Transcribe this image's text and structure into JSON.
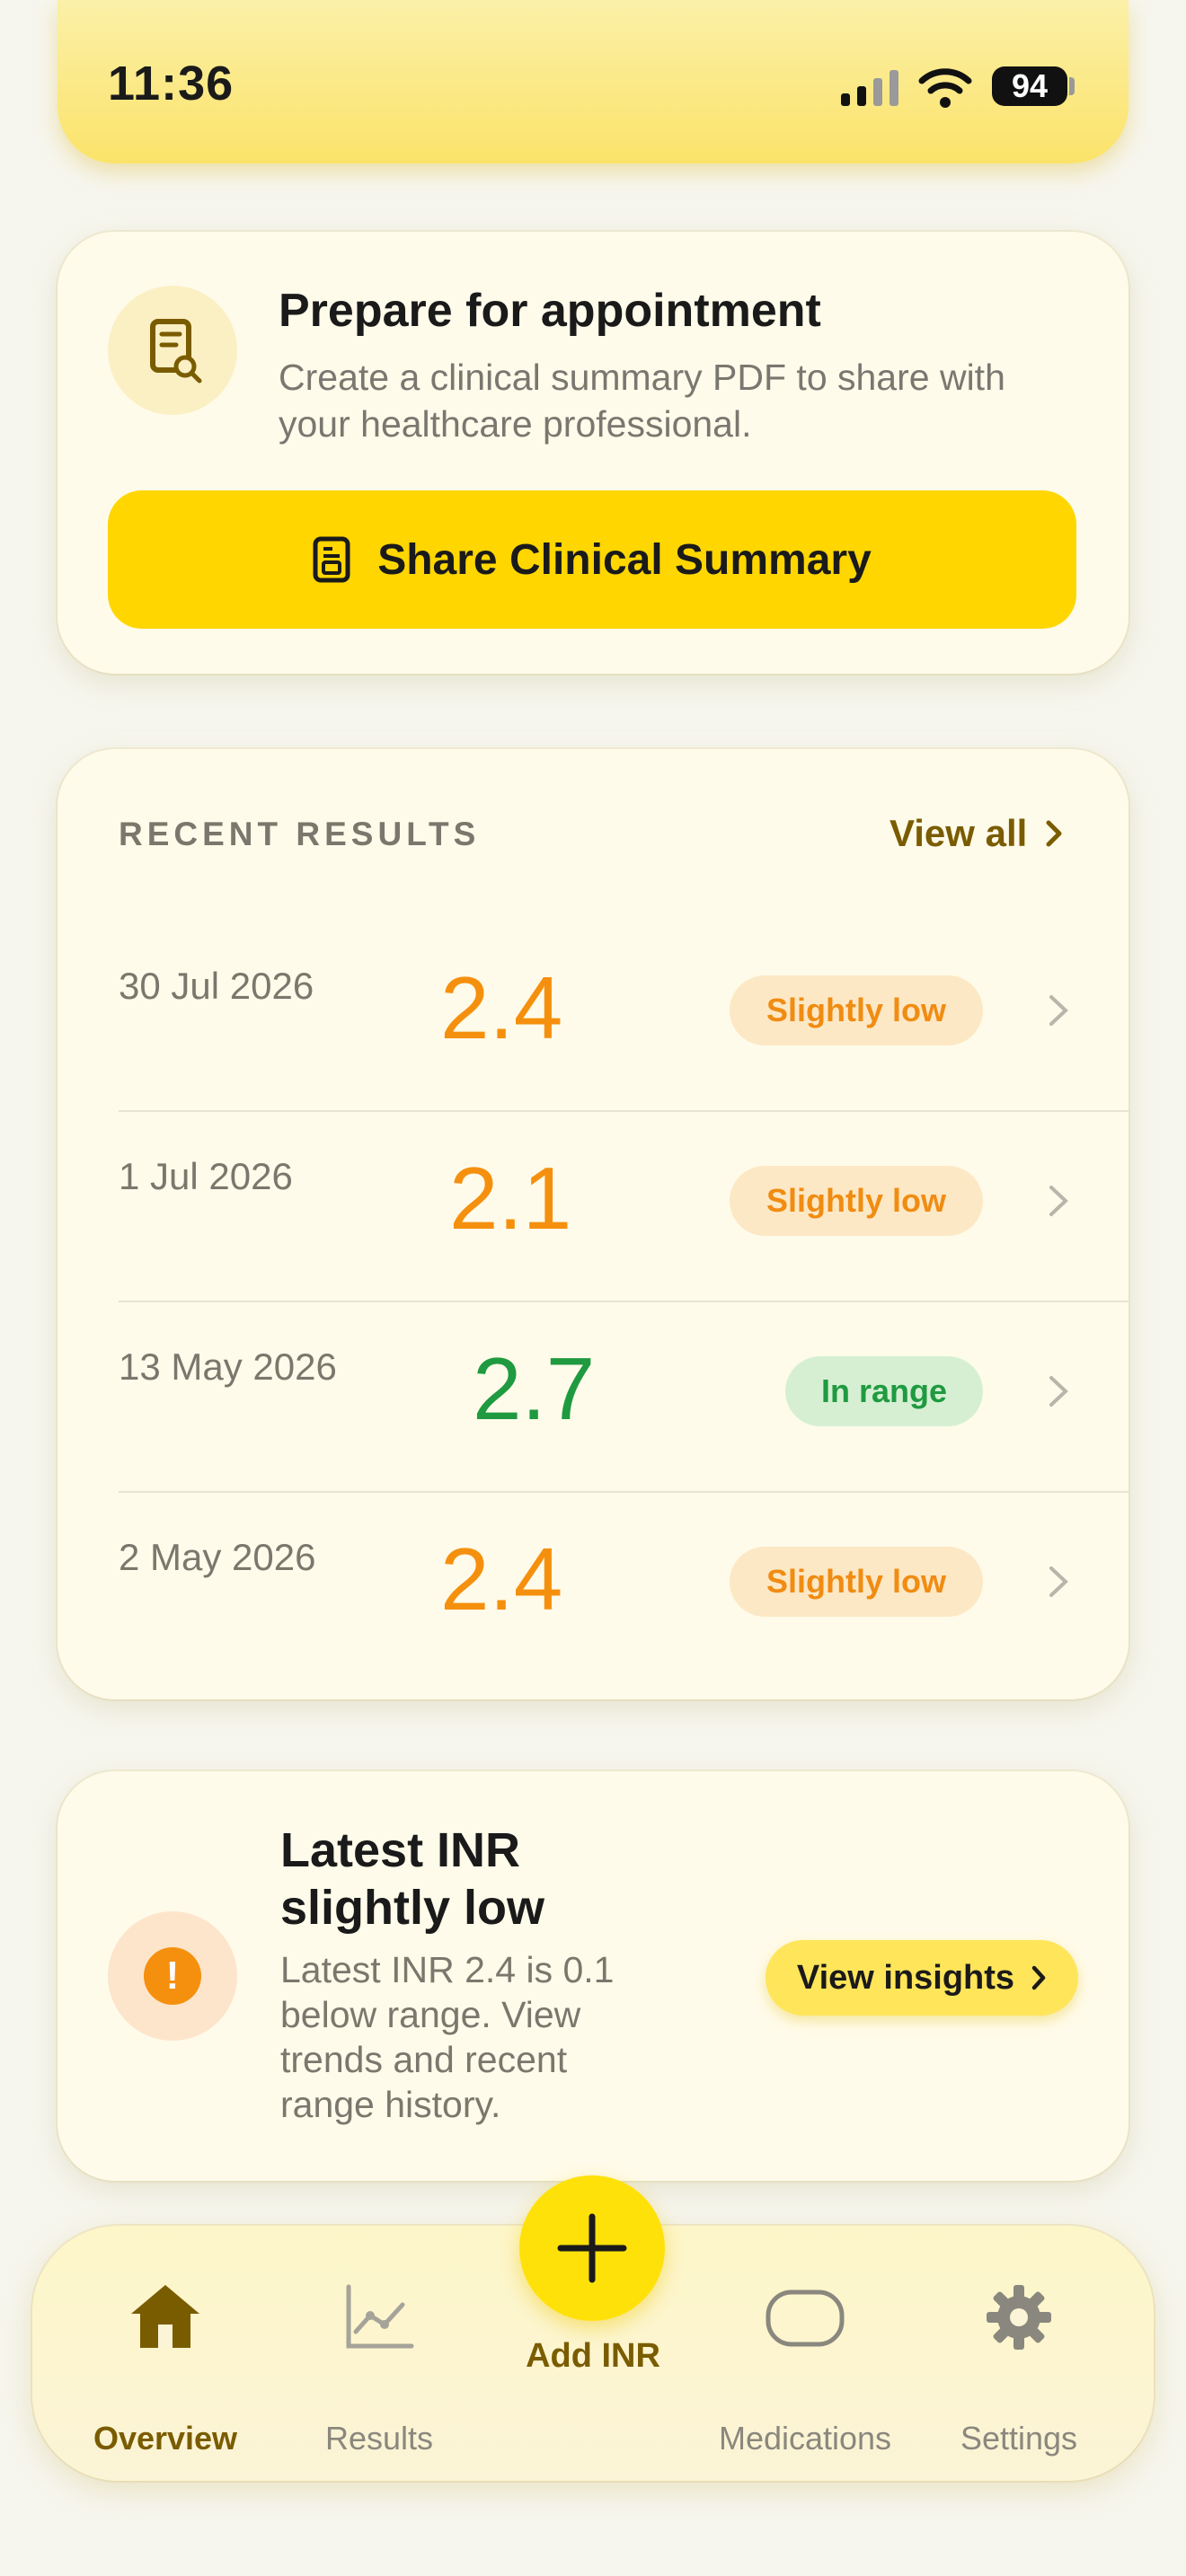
{
  "status_bar": {
    "time": "11:36",
    "battery": "94"
  },
  "appointment_card": {
    "title": "Prepare for appointment",
    "description": "Create a clinical summary PDF to share with your healthcare professional.",
    "button_label": "Share Clinical Summary"
  },
  "recent_results": {
    "title": "RECENT RESULTS",
    "view_all_label": "View all",
    "rows": [
      {
        "date": "30 Jul 2026",
        "value": "2.4",
        "status": "Slightly low"
      },
      {
        "date": "1 Jul 2026",
        "value": "2.1",
        "status": "Slightly low"
      },
      {
        "date": "13 May 2026",
        "value": "2.7",
        "status": "In range"
      },
      {
        "date": "2 May 2026",
        "value": "2.4",
        "status": "Slightly low"
      }
    ]
  },
  "insight_card": {
    "title": "Latest INR slightly low",
    "description": "Latest INR 2.4 is 0.1 below range. View trends and recent range history.",
    "button_label": "View insights"
  },
  "tab_bar": {
    "overview": "Overview",
    "results": "Results",
    "add": "Add INR",
    "medications": "Medications",
    "settings": "Settings"
  },
  "colors": {
    "accent": "#ffd600",
    "low": "#f5900e",
    "in_range": "#1f9a40",
    "active_tab": "#7a5c00"
  }
}
